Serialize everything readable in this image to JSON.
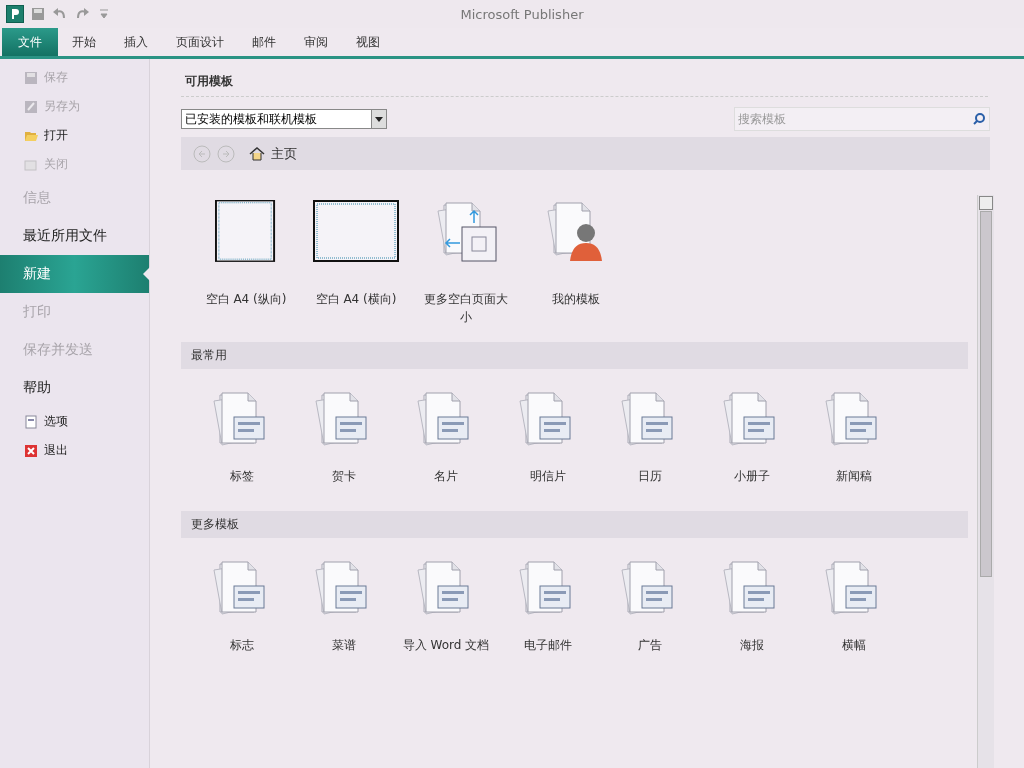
{
  "window": {
    "title": "Microsoft Publisher"
  },
  "ribbon_tabs": [
    {
      "label": "文件",
      "selected": true
    },
    {
      "label": "开始",
      "selected": false
    },
    {
      "label": "插入",
      "selected": false
    },
    {
      "label": "页面设计",
      "selected": false
    },
    {
      "label": "邮件",
      "selected": false
    },
    {
      "label": "审阅",
      "selected": false
    },
    {
      "label": "视图",
      "selected": false
    }
  ],
  "sidebar": {
    "items": [
      {
        "kind": "small",
        "label": "保存",
        "disabled": true,
        "selected": false
      },
      {
        "kind": "small",
        "label": "另存为",
        "disabled": true,
        "selected": false
      },
      {
        "kind": "small",
        "label": "打开",
        "disabled": false,
        "selected": false
      },
      {
        "kind": "small",
        "label": "关闭",
        "disabled": true,
        "selected": false
      },
      {
        "kind": "large",
        "label": "信息",
        "disabled": true,
        "selected": false
      },
      {
        "kind": "large",
        "label": "最近所用文件",
        "disabled": false,
        "selected": false
      },
      {
        "kind": "large",
        "label": "新建",
        "disabled": false,
        "selected": true
      },
      {
        "kind": "large",
        "label": "打印",
        "disabled": true,
        "selected": false
      },
      {
        "kind": "large",
        "label": "保存并发送",
        "disabled": true,
        "selected": false
      },
      {
        "kind": "large",
        "label": "帮助",
        "disabled": false,
        "selected": false
      },
      {
        "kind": "small",
        "label": "选项",
        "disabled": false,
        "selected": false
      },
      {
        "kind": "small",
        "label": "退出",
        "disabled": false,
        "selected": false
      }
    ]
  },
  "templates": {
    "heading": "可用模板",
    "source_dropdown": {
      "value": "已安装的模板和联机模板"
    },
    "search": {
      "placeholder": "搜索模板"
    },
    "breadcrumb": "主页",
    "top_items": [
      {
        "kind": "blank-portrait",
        "label": "空白 A4 (纵向)"
      },
      {
        "kind": "blank-landscape",
        "label": "空白 A4 (横向)"
      },
      {
        "kind": "page-sizes",
        "label": "更多空白页面大小"
      },
      {
        "kind": "my-templates",
        "label": "我的模板"
      }
    ],
    "sections": [
      {
        "title": "最常用",
        "items": [
          {
            "label": "标签"
          },
          {
            "label": "贺卡"
          },
          {
            "label": "名片"
          },
          {
            "label": "明信片"
          },
          {
            "label": "日历"
          },
          {
            "label": "小册子"
          },
          {
            "label": "新闻稿"
          }
        ]
      },
      {
        "title": "更多模板",
        "items": [
          {
            "label": "标志"
          },
          {
            "label": "菜谱"
          },
          {
            "label": "导入 Word 文档"
          },
          {
            "label": "电子邮件"
          },
          {
            "label": "广告"
          },
          {
            "label": "海报"
          },
          {
            "label": "横幅"
          }
        ]
      }
    ]
  }
}
